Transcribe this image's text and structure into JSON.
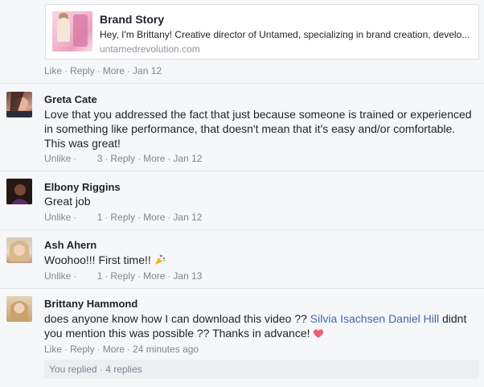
{
  "link_preview": {
    "title": "Brand Story",
    "description": "Hey, I'm Brittany! Creative director of Untamed, specializing in brand creation, develo...",
    "domain": "untamedrevolution.com",
    "actions": {
      "like": "Like",
      "reply": "Reply",
      "more": "More",
      "time": "Jan 12"
    }
  },
  "comments": [
    {
      "name": "Greta Cate",
      "text": "Love that you addressed the fact that just because someone is trained or experienced in something like performance, that doesn't mean that it's easy and/or comfortable. This was great!",
      "actions": {
        "like": "Unlike",
        "likes_count": "3",
        "reply": "Reply",
        "more": "More",
        "time": "Jan 12"
      }
    },
    {
      "name": "Elbony Riggins",
      "text": "Great job",
      "actions": {
        "like": "Unlike",
        "likes_count": "1",
        "reply": "Reply",
        "more": "More",
        "time": "Jan 12"
      }
    },
    {
      "name": "Ash Ahern",
      "text": "Woohoo!!! First time!!",
      "actions": {
        "like": "Unlike",
        "likes_count": "1",
        "reply": "Reply",
        "more": "More",
        "time": "Jan 13"
      }
    },
    {
      "name": "Brittany Hammond",
      "text_before": "does anyone know how I can download this video ?? ",
      "mention_1": "Silvia Isachsen",
      "mention_2": "Daniel Hill",
      "text_after": " didnt you mention this was possible ?? Thanks in advance!",
      "actions": {
        "like": "Like",
        "reply": "Reply",
        "more": "More",
        "time": "24 minutes ago"
      }
    }
  ],
  "replies_summary": "You replied · 4 replies",
  "separator": "·",
  "icons": {
    "party": "party-popper-icon",
    "heart": "heart-icon",
    "like": "thumbs-up-icon"
  },
  "colors": {
    "link_blue": "#4267b2",
    "meta_gray": "#90949c",
    "background": "#f6f7f9"
  }
}
